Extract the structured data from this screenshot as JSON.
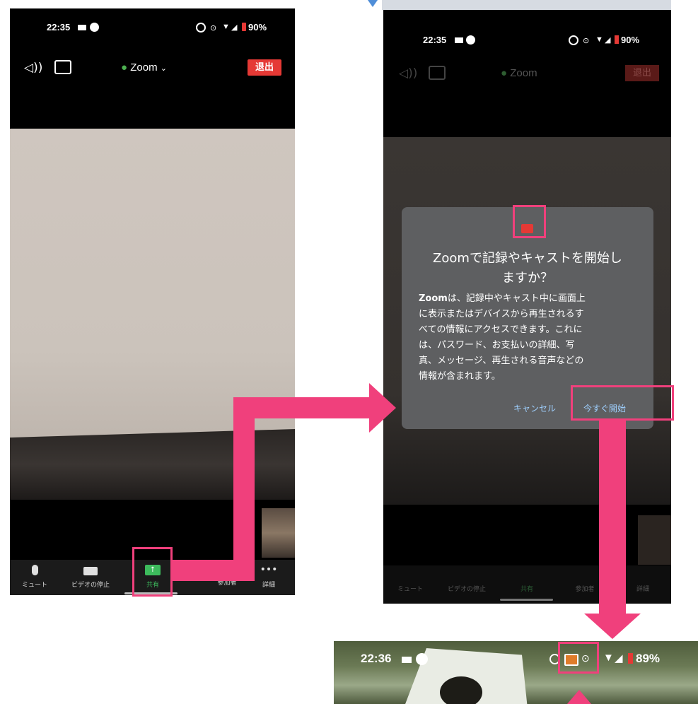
{
  "left_phone": {
    "status": {
      "time": "22:35",
      "battery": "90%"
    },
    "meeting_title": "Zoom",
    "leave_button": "退出",
    "toolbar": [
      {
        "label": "ミュート",
        "icon": "microphone-icon"
      },
      {
        "label": "ビデオの停止",
        "icon": "video-camera-icon"
      },
      {
        "label": "共有",
        "icon": "share-screen-icon"
      },
      {
        "label": "参加者",
        "icon": "participants-icon"
      },
      {
        "label": "詳細",
        "icon": "more-icon"
      }
    ]
  },
  "right_phone": {
    "status": {
      "time": "22:35",
      "battery": "90%"
    },
    "meeting_title": "Zoom",
    "leave_button": "退出",
    "dialog": {
      "title_line1": "Zoomで記録やキャストを開始し",
      "title_line2": "ますか？",
      "body_bold": "Zoom",
      "body_lines": [
        "は、記録中やキャスト中に画面上",
        "に表示またはデバイスから再生されるす",
        "べての情報にアクセスできます。これに",
        "は、パスワード、お支払いの詳細、写",
        "真、メッセージ、再生される音声などの",
        "情報が含まれます。"
      ],
      "cancel_label": "キャンセル",
      "start_label": "今すぐ開始"
    },
    "toolbar": [
      {
        "label": "ミュート"
      },
      {
        "label": "ビデオの停止"
      },
      {
        "label": "共有"
      },
      {
        "label": "参加者"
      },
      {
        "label": "詳細"
      }
    ]
  },
  "bottom_phone": {
    "status": {
      "time": "22:36",
      "battery": "89%"
    }
  },
  "colors": {
    "accent_pink": "#f0407c",
    "leave_red": "#e53935",
    "share_green": "#3dbb5c",
    "link_blue": "#9fd0ff"
  }
}
